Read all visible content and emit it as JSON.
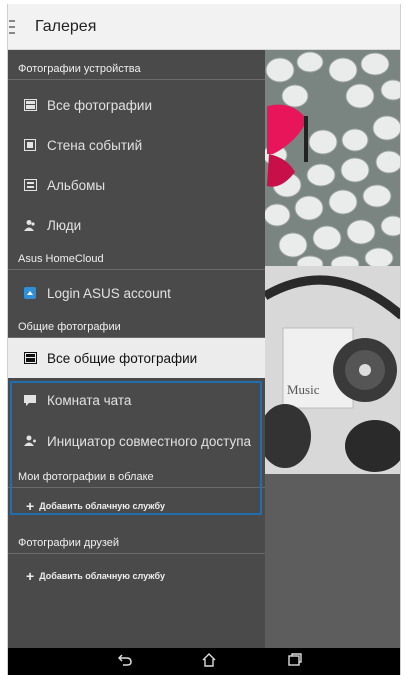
{
  "app": {
    "title": "Галерея"
  },
  "drawer": {
    "sections": {
      "device": "Фотографии устройства",
      "homecloud": "Asus HomeCloud",
      "shared": "Общие фотографии",
      "cloud": "Мои фотографии в облаке",
      "friends": "Фотографии друзей"
    },
    "device_items": [
      "Все фотографии",
      "Стена событий",
      "Альбомы",
      "Люди"
    ],
    "homecloud_items": [
      "Login ASUS account"
    ],
    "shared_items": [
      "Все общие фотографии",
      "Комната чата",
      "Инициатор совместного доступа"
    ],
    "cloud_add": "Добавить облачную службу",
    "friends_add": "Добавить облачную службу"
  },
  "photos": {
    "label": "Music"
  },
  "colors": {
    "accent": "#1f6fae",
    "drawer_bg": "#4a4a4a",
    "header_bg": "#f2f2f2",
    "selected_bg": "#ececec"
  },
  "icons": [
    "menu-icon",
    "photos-icon",
    "events-wall-icon",
    "album-icon",
    "people-icon",
    "homecloud-icon",
    "chat-icon",
    "share-initiator-icon",
    "plus-icon",
    "back-icon",
    "home-icon",
    "recents-icon"
  ]
}
